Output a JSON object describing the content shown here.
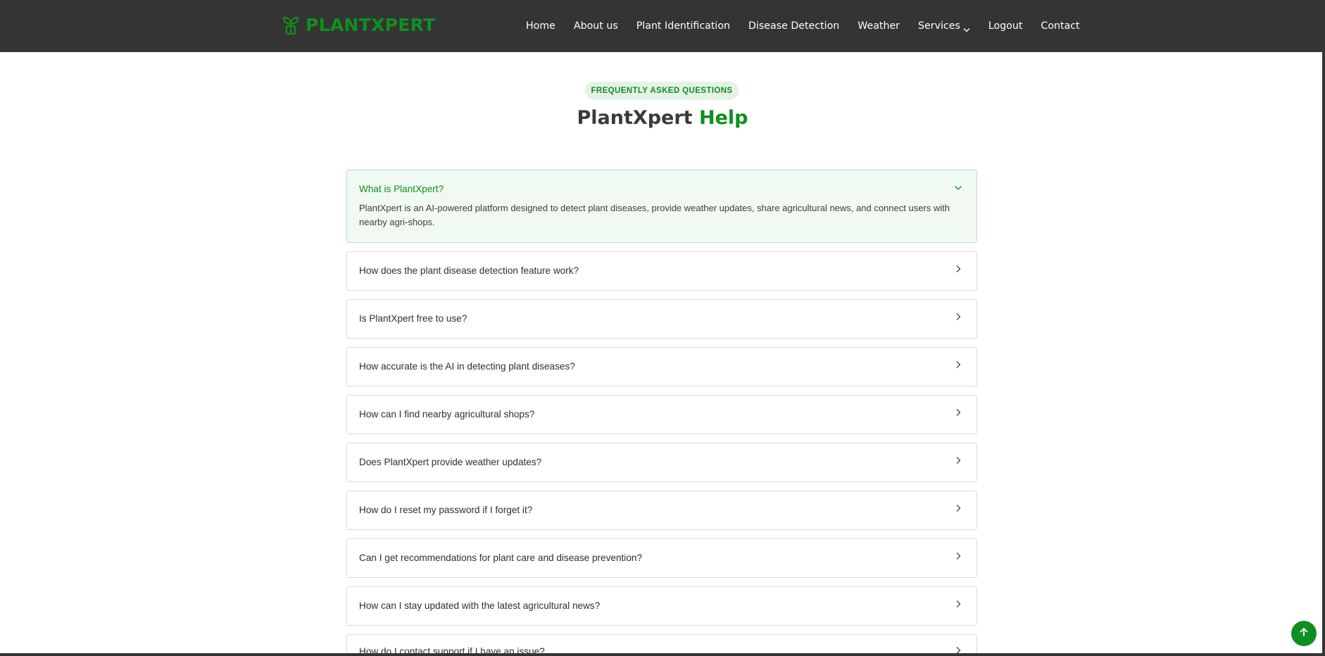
{
  "brand": {
    "name": "PLANTXPERT",
    "icon": "sprout-icon",
    "color": "#0f8f1f"
  },
  "nav": {
    "items": [
      {
        "label": "Home"
      },
      {
        "label": "About us"
      },
      {
        "label": "Plant Identification"
      },
      {
        "label": "Disease Detection"
      },
      {
        "label": "Weather"
      },
      {
        "label": "Services",
        "dropdown": true
      },
      {
        "label": "Logout"
      },
      {
        "label": "Contact"
      }
    ]
  },
  "header": {
    "badge": "FREQUENTLY ASKED QUESTIONS",
    "title_main": "PlantXpert",
    "title_accent": "Help"
  },
  "faqs": [
    {
      "question": "What is PlantXpert?",
      "answer": "PlantXpert is an AI-powered platform designed to detect plant diseases, provide weather updates, share agricultural news, and connect users with nearby agri-shops.",
      "open": true
    },
    {
      "question": "How does the plant disease detection feature work?",
      "open": false
    },
    {
      "question": "Is PlantXpert free to use?",
      "open": false
    },
    {
      "question": "How accurate is the AI in detecting plant diseases?",
      "open": false
    },
    {
      "question": "How can I find nearby agricultural shops?",
      "open": false
    },
    {
      "question": "Does PlantXpert provide weather updates?",
      "open": false
    },
    {
      "question": "How do I reset my password if I forget it?",
      "open": false
    },
    {
      "question": "Can I get recommendations for plant care and disease prevention?",
      "open": false
    },
    {
      "question": "How can I stay updated with the latest agricultural news?",
      "open": false
    },
    {
      "question": "How do I contact support if I have an issue?",
      "open": false
    }
  ],
  "colors": {
    "accent": "#0f8f1f",
    "navbar": "#343434",
    "open_bg": "#f1faf2"
  }
}
